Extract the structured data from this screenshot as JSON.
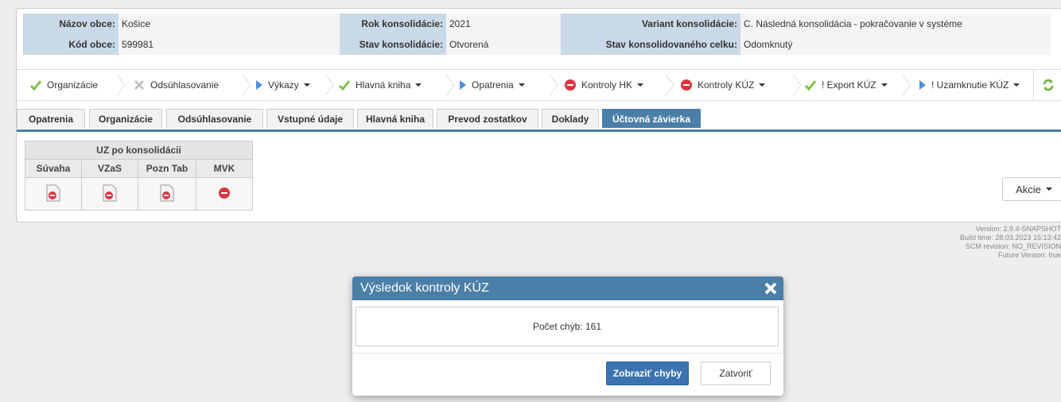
{
  "header": {
    "nazov_obce_label": "Názov obce:",
    "nazov_obce_value": "Košice",
    "kod_obce_label": "Kód obce:",
    "kod_obce_value": "599981",
    "rok_label": "Rok konsolidácie:",
    "rok_value": "2021",
    "stav_label": "Stav konsolidácie:",
    "stav_value": "Otvorená",
    "variant_label": "Variant konsolidácie:",
    "variant_value": "C. Následná konsolidácia - pokračovanie v systéme",
    "stav_celku_label": "Stav konsolidovaného celku:",
    "stav_celku_value": "Odomknutý"
  },
  "toolbar": {
    "items": [
      {
        "label": "Organizácie",
        "icon": "check-icon"
      },
      {
        "label": "Odsúhlasovanie",
        "icon": "cross-icon"
      },
      {
        "label": "Výkazy",
        "icon": "play-icon"
      },
      {
        "label": "Hlavná kniha",
        "icon": "check-icon"
      },
      {
        "label": "Opatrenia",
        "icon": "play-icon"
      },
      {
        "label": "Kontroly HK",
        "icon": "stop-icon"
      },
      {
        "label": "Kontroly KÚZ",
        "icon": "stop-icon"
      },
      {
        "label": "! Export KÚZ",
        "icon": "check-icon"
      },
      {
        "label": "! Uzamknutie KÚZ",
        "icon": "play-icon"
      }
    ]
  },
  "tabs": [
    "Opatrenia",
    "Organizácie",
    "Odsúhlasovanie",
    "Vstupné údaje",
    "Hlavná kniha",
    "Prevod zostatkov",
    "Doklady",
    "Účtovná závierka"
  ],
  "active_tab": "Účtovná závierka",
  "uz_table": {
    "title": "UZ po konsolidácii",
    "columns": [
      "Súvaha",
      "VZaS",
      "Pozn Tab",
      "MVK"
    ]
  },
  "akcie_label": "Akcie",
  "version": {
    "line1": "Version: 2.9.4-SNAPSHOT",
    "line2": "Build time: 28.03.2023 15:13:42",
    "line3": "SCM revision: NO_REVISION",
    "line4": "Future Version: true"
  },
  "modal": {
    "title": "Výsledok kontroly KÚZ",
    "message": "Počet chýb: 161",
    "primary_button": "Zobraziť chyby",
    "secondary_button": "Zatvoriť"
  },
  "colors": {
    "accent": "#4a7fa8",
    "primary_button": "#3b73b1",
    "header_label_bg": "#c9d9e8",
    "error_red": "#d9363e",
    "check_green": "#7cc142"
  }
}
